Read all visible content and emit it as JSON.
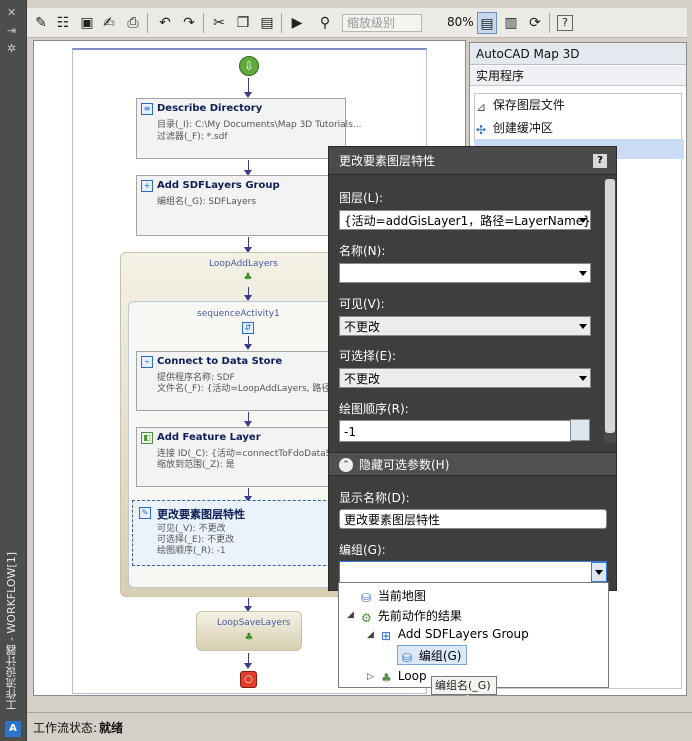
{
  "window": {
    "vertical_title": "工作流设计器 - WORKFLOW[1]"
  },
  "toolbar": {
    "zoom_placeholder": "缩放级别",
    "zoom_value": "80%",
    "help_label": "?"
  },
  "workflow": {
    "activities": [
      {
        "title": "Describe Directory",
        "params": [
          "目录(_I): C:\\My Documents\\Map 3D Tutorials...",
          "过滤器(_F): *.sdf"
        ]
      },
      {
        "title": "Add SDFLayers Group",
        "params": [
          "编组名(_G): SDFLayers"
        ]
      },
      {
        "title": "Connect to Data Store",
        "params": [
          "提供程序名称: SDF",
          "文件名(_F): {活动=LoopAddLayers, 路径=..."
        ]
      },
      {
        "title": "Add Feature Layer",
        "params": [
          "连接 ID(_C): {活动=connectToFdoDataSto...",
          "缩放到范围(_Z): 是"
        ]
      },
      {
        "title": "更改要素图层特性",
        "params": [
          "可见(_V): 不更改",
          "可选择(_E): 不更改",
          "绘图顺序(_R): -1"
        ]
      }
    ],
    "loop_add": "LoopAddLayers",
    "sequence": "sequenceActivity1",
    "loop_save": "LoopSaveLayers"
  },
  "right_panel": {
    "header": "AutoCAD Map 3D",
    "subheader": "实用程序",
    "items": [
      "保存图层文件",
      "创建缓冲区"
    ]
  },
  "status": {
    "label": "工作流状态:",
    "value": "就绪"
  },
  "dialog": {
    "title": "更改要素图层特性",
    "help": "?",
    "layer_label": "图层(L):",
    "layer_value": "{活动=addGisLayer1，路径=LayerName}",
    "name_label": "名称(N):",
    "name_value": "",
    "visible_label": "可见(V):",
    "visible_value": "不更改",
    "selectable_label": "可选择(E):",
    "selectable_value": "不更改",
    "draworder_label": "绘图顺序(R):",
    "draworder_value": "-1",
    "hide_optional": "隐藏可选参数(H)",
    "display_name_label": "显示名称(D):",
    "display_name_value": "更改要素图层特性",
    "group_label": "编组(G):",
    "group_value": ""
  },
  "dropdown": {
    "items": [
      "当前地图",
      "先前动作的结果",
      "Add SDFLayers Group",
      "编组(G)",
      "Loop"
    ]
  },
  "tooltip": "编组名(_G)"
}
